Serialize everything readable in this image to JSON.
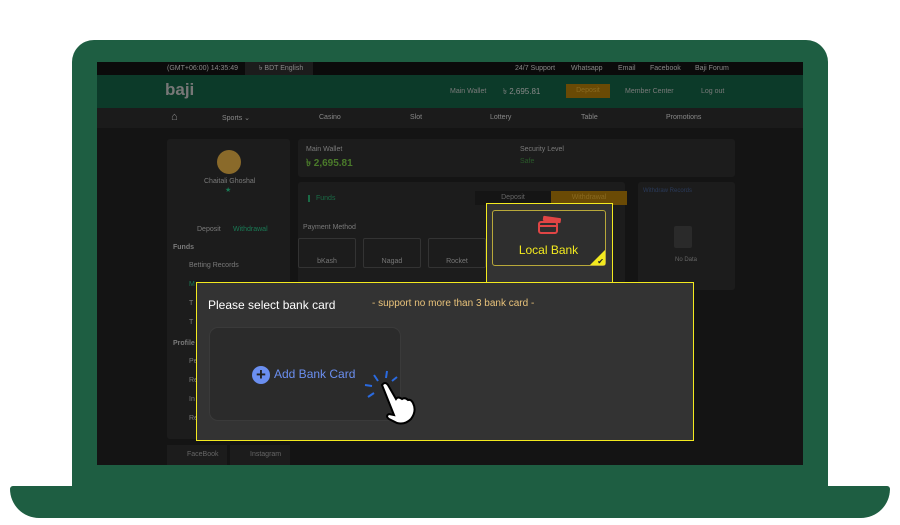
{
  "topbar": {
    "time": "(GMT+06:00) 14:35:49",
    "language": "৳ BDT English",
    "links": [
      "24/7 Support",
      "Whatsapp",
      "Email",
      "Facebook",
      "Baji Forum"
    ]
  },
  "header": {
    "logo": "baji",
    "wallet_label": "Main Wallet",
    "balance": "৳ 2,695.81",
    "deposit": "Deposit",
    "member_center": "Member Center",
    "logout": "Log out"
  },
  "nav": [
    "Sports ⌄",
    "Casino",
    "Slot",
    "Lottery",
    "Table",
    "Promotions"
  ],
  "sidebar": {
    "user": "Chaitali Ghoshal",
    "deposit": "Deposit",
    "withdrawal": "Withdrawal",
    "funds_heading": "Funds",
    "funds_items": [
      "Betting Records",
      "M",
      "T",
      "T"
    ],
    "profile_heading": "Profile",
    "profile_items": [
      "Pe",
      "Re",
      "In",
      "Re"
    ]
  },
  "wallet": {
    "label": "Main Wallet",
    "amount": "৳ 2,695.81",
    "security_label": "Security Level",
    "security_value": "Safe"
  },
  "funds": {
    "title": "Funds",
    "tabs": [
      "Deposit",
      "Withdrawal"
    ],
    "payment_method": "Payment Method",
    "methods": [
      "bKash",
      "Nagad",
      "Rocket"
    ],
    "selected": "Local Bank"
  },
  "records": {
    "title": "Withdraw Records",
    "empty": "No Data"
  },
  "community": [
    "FaceBook",
    "Instagram"
  ],
  "modal": {
    "title": "Please select bank card",
    "note": "- support no more than 3 bank card -",
    "add_card": "Add Bank Card"
  },
  "colors": {
    "laptop": "#1e5e42",
    "highlight": "#f3ea1f",
    "accent": "#6b8ff0",
    "note": "#e8c27a"
  }
}
